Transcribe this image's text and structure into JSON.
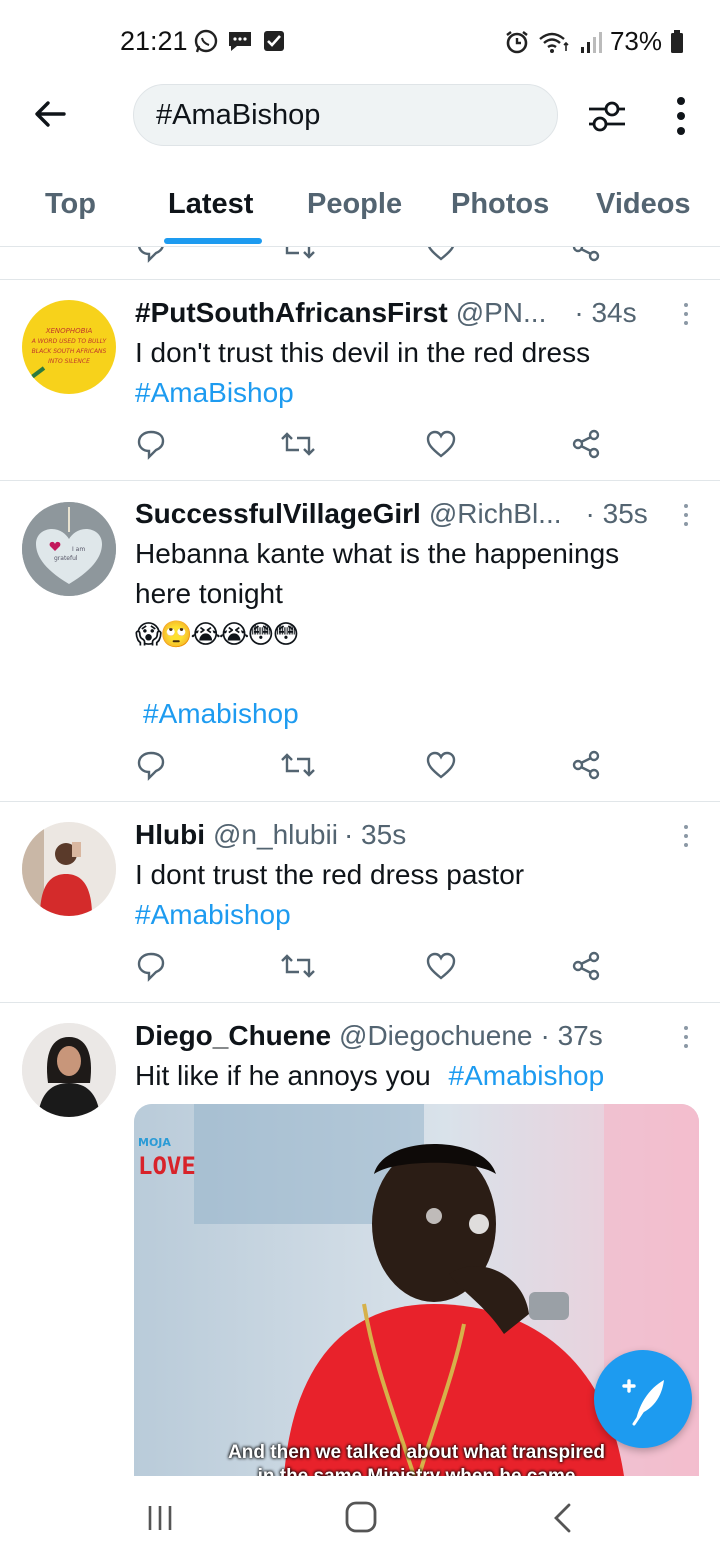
{
  "status_bar": {
    "time": "21:21",
    "battery": "73%",
    "left_icons": [
      "whatsapp-icon",
      "message-icon",
      "checkbox-icon"
    ],
    "right_icons": [
      "alarm-icon",
      "wifi-icon",
      "signal-icon",
      "battery-icon"
    ]
  },
  "search": {
    "query": "#AmaBishop"
  },
  "tabs": [
    {
      "label": "Top"
    },
    {
      "label": "Latest"
    },
    {
      "label": "People"
    },
    {
      "label": "Photos"
    },
    {
      "label": "Videos"
    }
  ],
  "active_tab": "Latest",
  "tweets": [
    {
      "name": "#PutSouthAfricansFirst",
      "handle": "@PN...",
      "time": "· 34s",
      "text": "I don't trust this devil in the red dress",
      "hashtag": "#AmaBishop",
      "avatar_text": [
        "XENOPHOBIA",
        "A WORD USED TO BULLY",
        "BLACK SOUTH AFRICANS",
        "INTO SILENCE"
      ]
    },
    {
      "name": "SuccessfulVillageGirl",
      "handle": "@RichBl...",
      "time": "· 35s",
      "text_line1": "Hebanna kante what is the happenings",
      "text_line2": "here tonight",
      "emojis": "😱🙄😭😭😳😳",
      "hashtag": "#Amabishop",
      "avatar_text": [
        "I am",
        "grateful"
      ]
    },
    {
      "name": "Hlubi",
      "handle": "@n_hlubii",
      "time": "· 35s",
      "text": "I dont trust the red dress pastor",
      "hashtag": "#Amabishop"
    },
    {
      "name": "Diego_Chuene",
      "handle": "@Diegochuene",
      "time": "· 37s",
      "text": "Hit like if he annoys you",
      "hashtag": "#Amabishop",
      "media": {
        "logo_line1": "MOJA",
        "logo_line2": "LOVE",
        "caption_line1": "And then we talked about what transpired",
        "caption_line2": "in the same Ministry when he came"
      }
    }
  ],
  "colors": {
    "accent": "#1d9bf0",
    "text": "#0f1419",
    "secondary": "#536471",
    "divider": "#e1e6e9"
  }
}
